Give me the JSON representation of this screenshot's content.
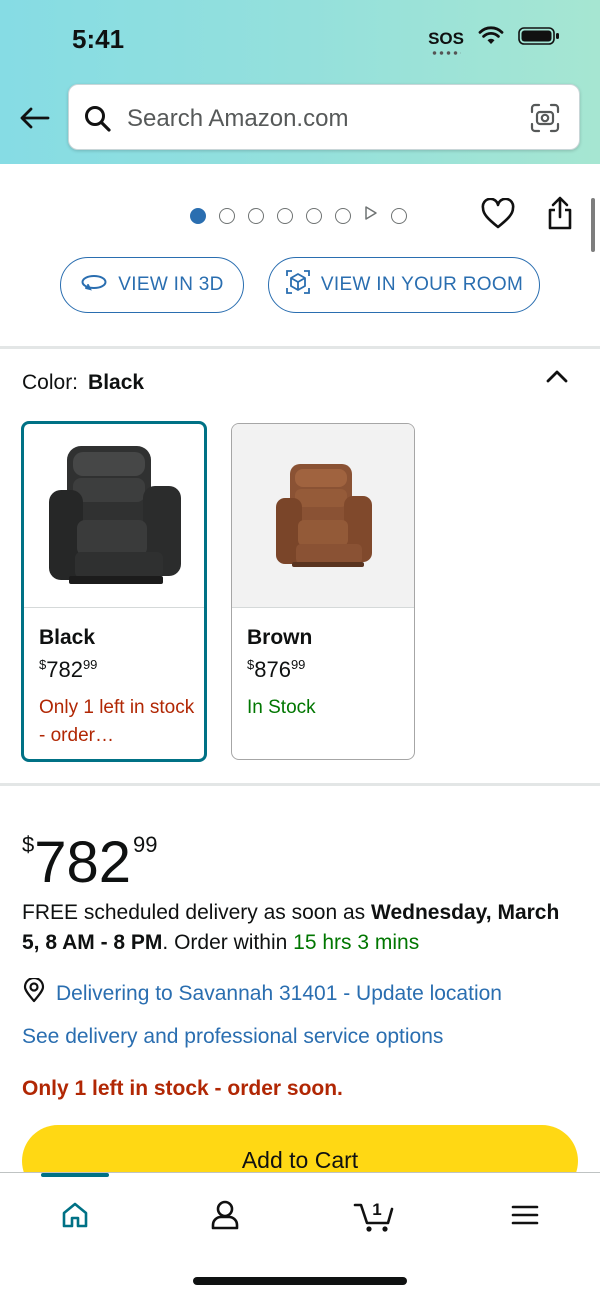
{
  "status_bar": {
    "time": "5:41",
    "sos": "SOS"
  },
  "search": {
    "placeholder": "Search Amazon.com"
  },
  "carousel": {
    "dot_count": 7,
    "active_index": 0
  },
  "view_buttons": {
    "view_3d": "VIEW IN 3D",
    "view_room": "VIEW IN YOUR ROOM"
  },
  "color": {
    "label": "Color:",
    "selected": "Black",
    "options": [
      {
        "name": "Black",
        "currency": "$",
        "price_whole": "782",
        "price_cents": "99",
        "stock": "Only 1 left in stock - order…"
      },
      {
        "name": "Brown",
        "currency": "$",
        "price_whole": "876",
        "price_cents": "99",
        "stock": "In Stock"
      }
    ]
  },
  "price": {
    "currency": "$",
    "whole": "782",
    "cents": "99"
  },
  "delivery": {
    "prefix": "FREE scheduled delivery as soon as ",
    "date": "Wednesday, March 5, 8 AM - 8 PM",
    "middle": ". Order within ",
    "countdown": "15 hrs 3 mins"
  },
  "location": {
    "text": "Delivering to Savannah 31401 - Update location"
  },
  "service_link": "See delivery and professional service options",
  "stock_warning": "Only 1 left in stock - order soon.",
  "add_to_cart": "Add to Cart",
  "bottom_nav": {
    "cart_count": "1"
  },
  "colors": {
    "link": "#2a6eb0",
    "teal": "#007185",
    "cta": "#ffd814",
    "alert": "#b12704",
    "in_stock": "#007600"
  }
}
